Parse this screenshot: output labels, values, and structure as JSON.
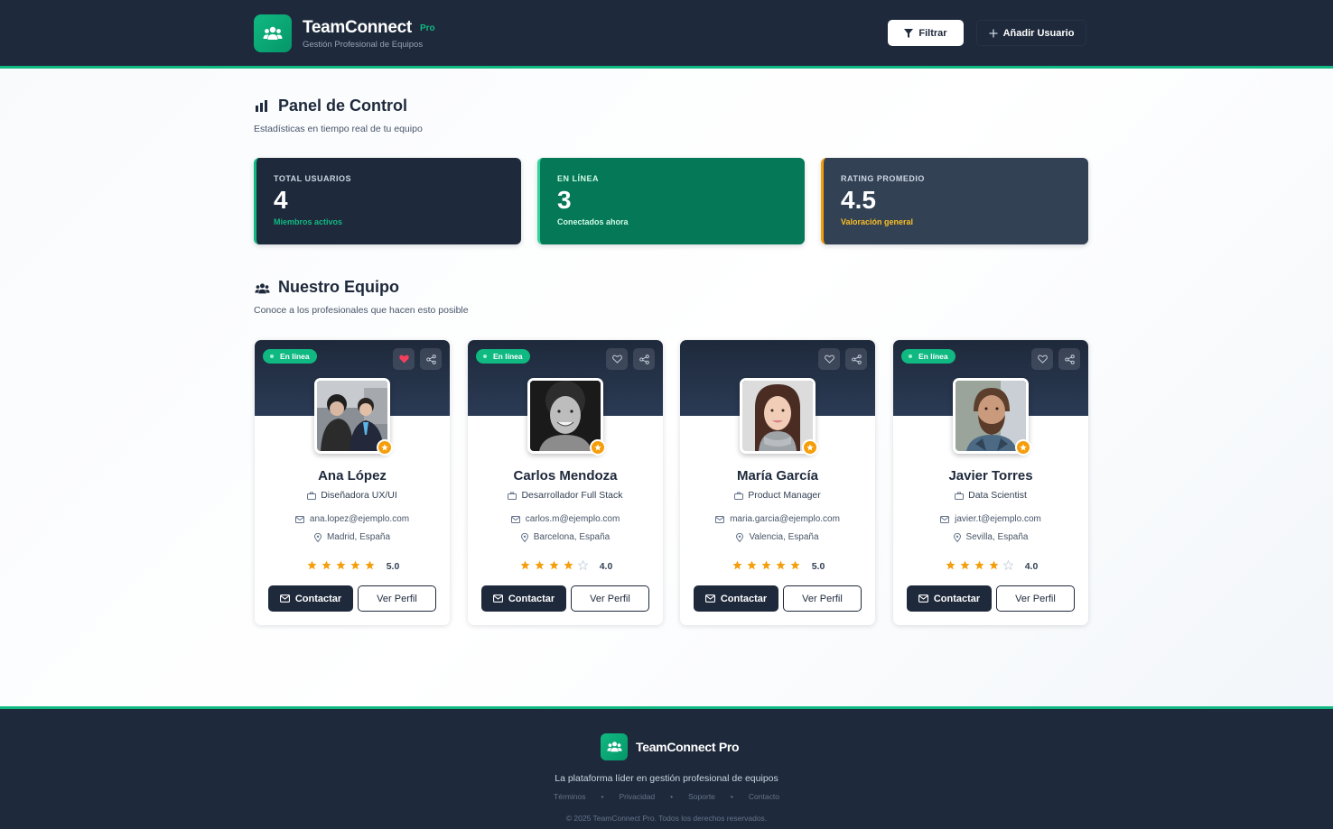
{
  "header": {
    "brand": "TeamConnect",
    "badge": "Pro",
    "subtitle": "Gestión Profesional de Equipos",
    "filter_label": "Filtrar",
    "add_user_label": "Añadir Usuario"
  },
  "dashboard": {
    "title": "Panel de Control",
    "subtitle": "Estadísticas en tiempo real de tu equipo",
    "stats": [
      {
        "label": "TOTAL USUARIOS",
        "value": "4",
        "note": "Miembros activos",
        "accent": "#10b981"
      },
      {
        "label": "EN LÍNEA",
        "value": "3",
        "note": "Conectados ahora",
        "accent": "#10b981"
      },
      {
        "label": "RATING PROMEDIO",
        "value": "4.5",
        "note": "Valoración general",
        "accent": "#f59e0b"
      }
    ]
  },
  "team": {
    "title": "Nuestro Equipo",
    "subtitle": "Conoce a los profesionales que hacen esto posible",
    "contact_label": "Contactar",
    "profile_label": "Ver Perfil",
    "online_label": "En línea",
    "members": [
      {
        "name": "Ana López",
        "role": "Diseñadora UX/UI",
        "email": "ana.lopez@ejemplo.com",
        "location": "Madrid, España",
        "rating": "5.0",
        "stars": 5,
        "online": true,
        "favorite": true
      },
      {
        "name": "Carlos Mendoza",
        "role": "Desarrollador Full Stack",
        "email": "carlos.m@ejemplo.com",
        "location": "Barcelona, España",
        "rating": "4.0",
        "stars": 4,
        "online": true,
        "favorite": false
      },
      {
        "name": "María García",
        "role": "Product Manager",
        "email": "maria.garcia@ejemplo.com",
        "location": "Valencia, España",
        "rating": "5.0",
        "stars": 5,
        "online": false,
        "favorite": false
      },
      {
        "name": "Javier Torres",
        "role": "Data Scientist",
        "email": "javier.t@ejemplo.com",
        "location": "Sevilla, España",
        "rating": "4.0",
        "stars": 4,
        "online": true,
        "favorite": false
      }
    ]
  },
  "footer": {
    "brand": "TeamConnect Pro",
    "tagline": "La plataforma líder en gestión profesional de equipos",
    "links": [
      "Términos",
      "Privacidad",
      "Soporte",
      "Contacto"
    ],
    "copyright": "© 2025 TeamConnect Pro. Todos los derechos reservados."
  },
  "colors": {
    "navy": "#1e293b",
    "green": "#10b981",
    "amber": "#f59e0b"
  }
}
